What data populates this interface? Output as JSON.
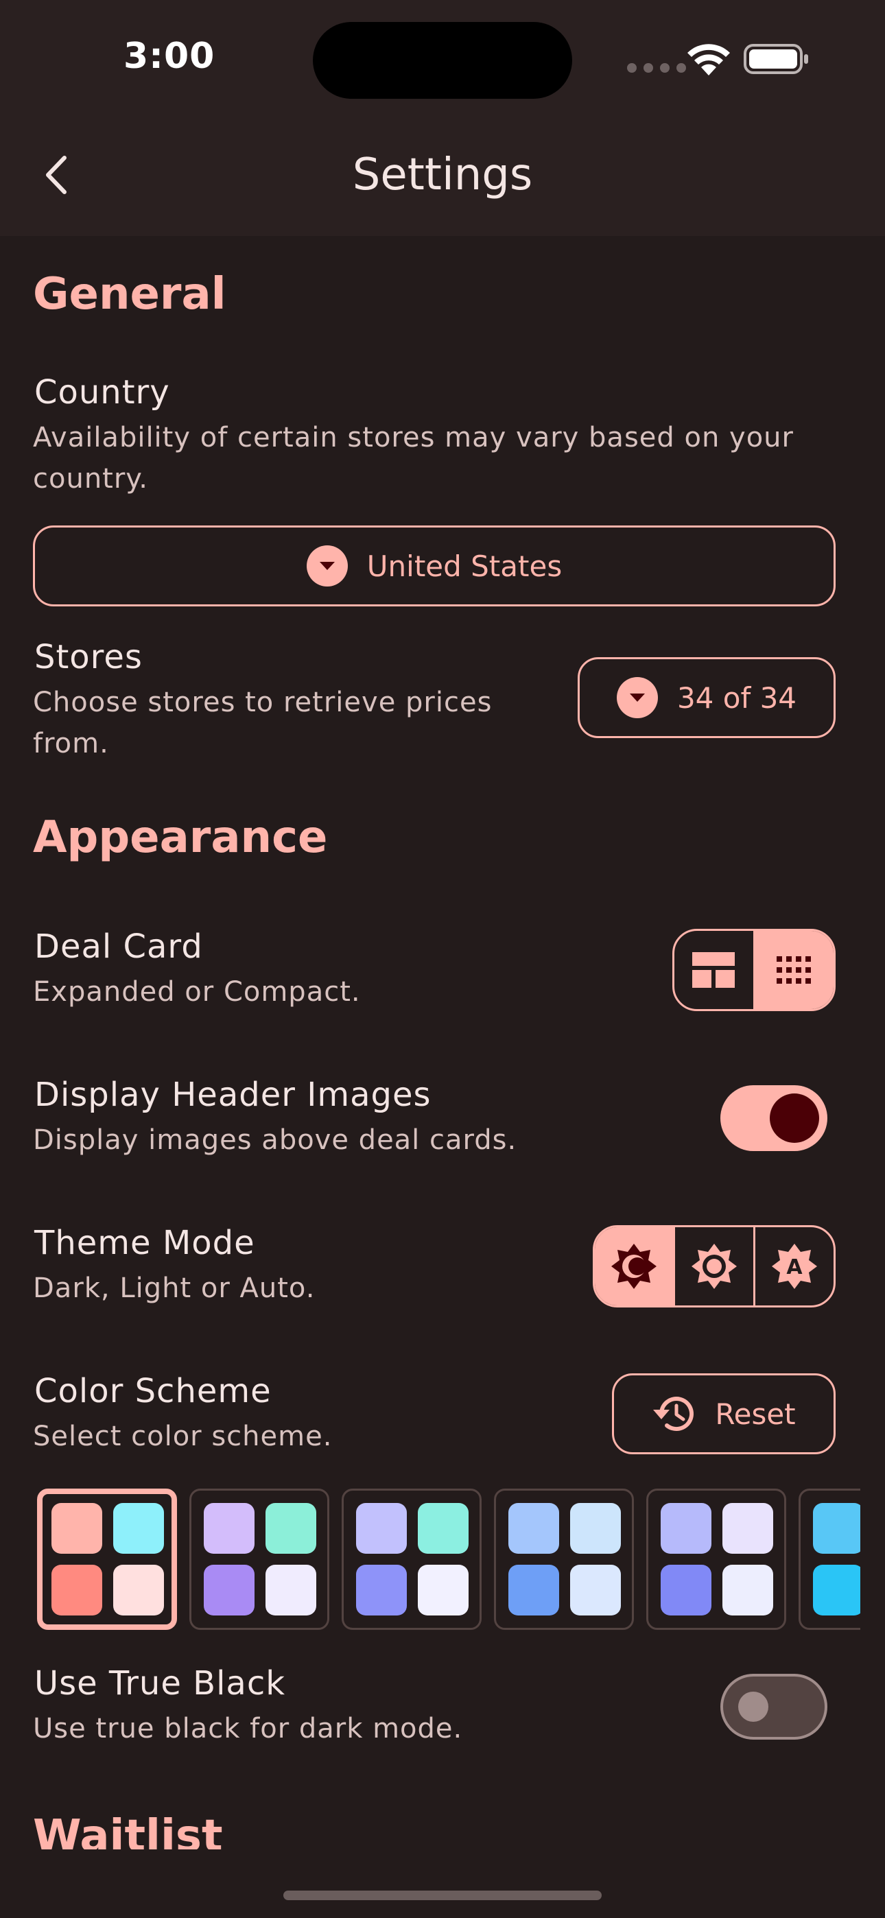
{
  "status_bar": {
    "time": "3:00"
  },
  "nav": {
    "title": "Settings"
  },
  "general": {
    "title": "General",
    "country": {
      "title": "Country",
      "subtitle_line1": "Availability of certain stores may vary based on your",
      "subtitle_line2": "country.",
      "value": "United States"
    },
    "stores": {
      "title": "Stores",
      "subtitle_line1": "Choose stores to retrieve prices",
      "subtitle_line2": "from.",
      "value": "34 of 34"
    }
  },
  "appearance": {
    "title": "Appearance",
    "deal_card": {
      "title": "Deal Card",
      "subtitle": "Expanded or Compact.",
      "selected": "compact"
    },
    "header_images": {
      "title": "Display Header Images",
      "subtitle": "Display images above deal cards.",
      "enabled": true
    },
    "theme_mode": {
      "title": "Theme Mode",
      "subtitle": "Dark, Light or Auto.",
      "selected": "dark"
    },
    "color_scheme": {
      "title": "Color Scheme",
      "subtitle": "Select color scheme.",
      "reset_label": "Reset",
      "schemes": [
        {
          "colors": [
            "#ffb4ab",
            "#8ef0fb",
            "#ff8a80",
            "#ffe0df"
          ],
          "selected": true
        },
        {
          "colors": [
            "#d3bdfb",
            "#8cefd9",
            "#a98bf4",
            "#f0ecfe"
          ],
          "selected": false
        },
        {
          "colors": [
            "#c2c1fd",
            "#8cefe1",
            "#8e93f9",
            "#f2f1ff"
          ],
          "selected": false
        },
        {
          "colors": [
            "#a4c6fc",
            "#cde5fc",
            "#6e9ff6",
            "#dbe8fe"
          ],
          "selected": false
        },
        {
          "colors": [
            "#b6bafb",
            "#e9e3fd",
            "#8189f6",
            "#edeefe"
          ],
          "selected": false
        },
        {
          "colors": [
            "#58c7f6",
            "#ffffff",
            "#2ac5f6",
            "#ffffff"
          ],
          "selected": false
        }
      ]
    },
    "true_black": {
      "title": "Use True Black",
      "subtitle": "Use true black for dark mode.",
      "enabled": false
    }
  },
  "waitlist": {
    "title": "Waitlist"
  },
  "colors": {
    "accent": "#ffb4ab",
    "background": "#231b1b",
    "bar": "#2a2020",
    "on_accent": "#4b0006"
  }
}
